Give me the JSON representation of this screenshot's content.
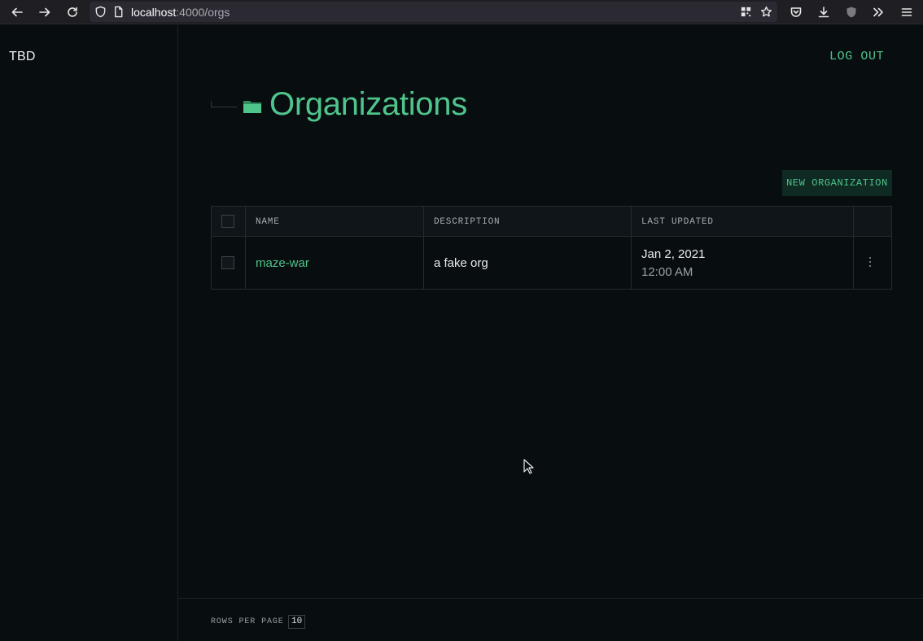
{
  "browser": {
    "url_host": "localhost",
    "url_path": ":4000/orgs"
  },
  "sidebar": {
    "brand": "TBD"
  },
  "header": {
    "logout_label": "LOG OUT"
  },
  "page": {
    "title": "Organizations",
    "new_button_label": "NEW ORGANIZATION"
  },
  "table": {
    "columns": [
      "NAME",
      "DESCRIPTION",
      "LAST UPDATED"
    ],
    "rows": [
      {
        "name": "maze-war",
        "description": "a fake org",
        "date": "Jan 2, 2021",
        "time": "12:00 AM"
      }
    ]
  },
  "footer": {
    "rows_per_page_label": "ROWS PER PAGE",
    "rows_per_page_value": "10"
  },
  "colors": {
    "accent": "#4fc48b",
    "background": "#080d10",
    "button_bg": "#0e2a22"
  }
}
